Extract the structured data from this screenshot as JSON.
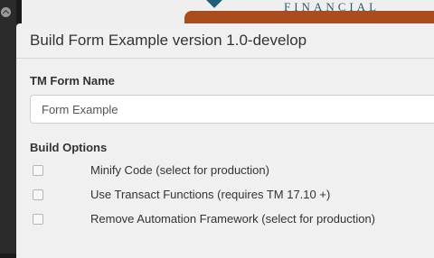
{
  "header": {
    "brand_text": "FINANCIAL"
  },
  "modal": {
    "title": "Build Form Example version 1.0-develop",
    "form_name_label": "TM Form Name",
    "form_name_value": "Form Example",
    "build_options_label": "Build Options",
    "options": [
      {
        "label": "Minify Code (select for production)",
        "checked": false
      },
      {
        "label": "Use Transact Functions (requires TM 17.10 +)",
        "checked": false
      },
      {
        "label": "Remove Automation Framework (select for production)",
        "checked": false
      }
    ]
  },
  "colors": {
    "accent_orange": "#a94d1f",
    "brand_teal": "#1f5f78"
  },
  "icons": [
    "chevron-up-icon",
    "brand-logo-icon"
  ]
}
